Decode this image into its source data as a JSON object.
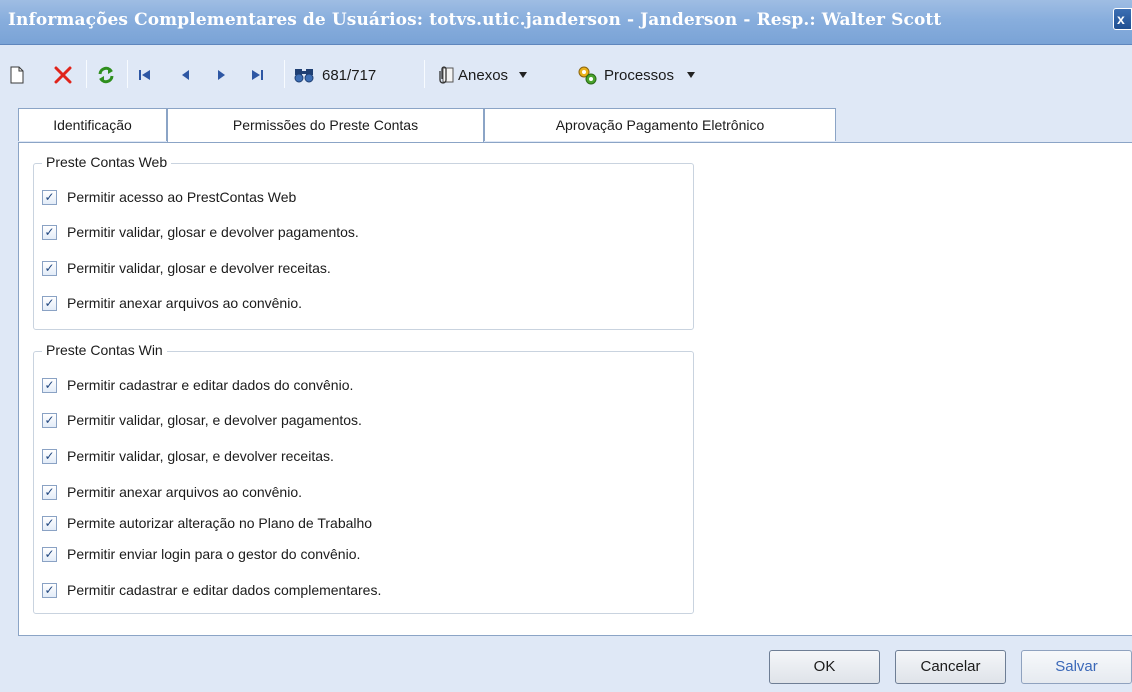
{
  "window": {
    "title": "Informações Complementares de Usuários: totvs.utic.janderson - Janderson - Resp.: Walter Scott",
    "close_glyph": "x"
  },
  "toolbar": {
    "record_counter": "681/717",
    "attachments_label": "Anexos",
    "processes_label": "Processos",
    "icons": [
      "new-icon",
      "delete-icon",
      "refresh-icon",
      "first-record-icon",
      "previous-record-icon",
      "next-record-icon",
      "last-record-icon",
      "find-icon",
      "attachments-icon",
      "processes-icon"
    ]
  },
  "tabs": [
    {
      "label": "Identificação",
      "active": false
    },
    {
      "label": "Permissões do Preste Contas",
      "active": true
    },
    {
      "label": "Aprovação Pagamento Eletrônico",
      "active": false
    }
  ],
  "groups": {
    "web": {
      "title": "Preste Contas Web",
      "items": [
        {
          "label": "Permitir acesso ao PrestContas Web",
          "checked": true
        },
        {
          "label": "Permitir validar, glosar e devolver pagamentos.",
          "checked": true
        },
        {
          "label": "Permitir validar, glosar e devolver receitas.",
          "checked": true
        },
        {
          "label": "Permitir anexar arquivos ao convênio.",
          "checked": true
        }
      ]
    },
    "win": {
      "title": "Preste Contas Win",
      "items": [
        {
          "label": "Permitir cadastrar e editar dados do convênio.",
          "checked": true
        },
        {
          "label": "Permitir validar, glosar, e devolver pagamentos.",
          "checked": true
        },
        {
          "label": "Permitir validar, glosar, e devolver receitas.",
          "checked": true
        },
        {
          "label": "Permitir anexar arquivos ao convênio.",
          "checked": true
        },
        {
          "label": "Permite autorizar alteração no Plano de Trabalho",
          "checked": true
        },
        {
          "label": "Permitir enviar login para o gestor do convênio.",
          "checked": true
        },
        {
          "label": "Permitir cadastrar e editar dados complementares.",
          "checked": true
        }
      ]
    }
  },
  "buttons": {
    "ok": "OK",
    "cancel": "Cancelar",
    "save": "Salvar"
  },
  "colors": {
    "titlebar": "#88aedd",
    "background": "#dfe8f6",
    "panel": "#ffffff",
    "accent": "#3b68b8"
  }
}
